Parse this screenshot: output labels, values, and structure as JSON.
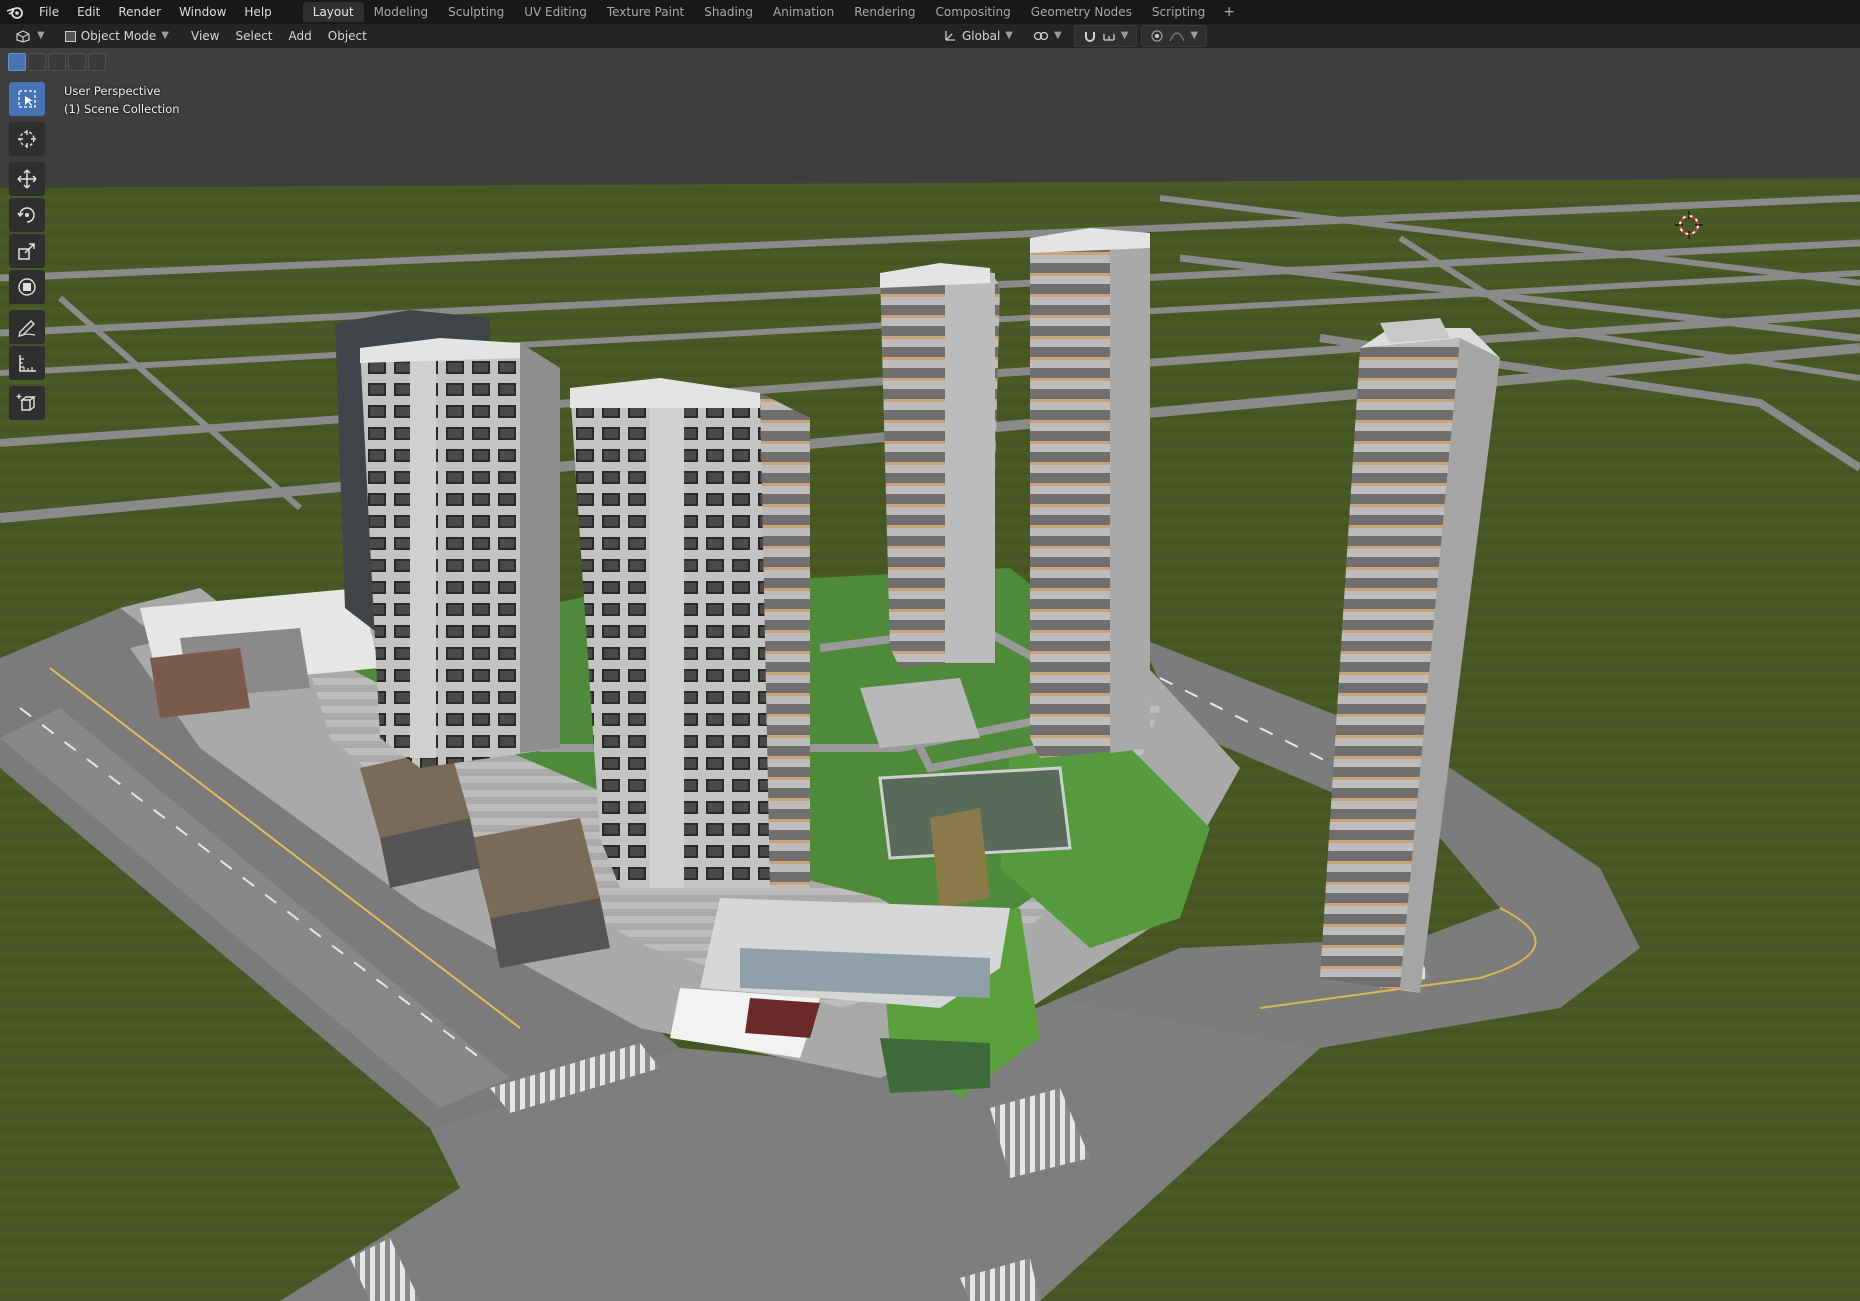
{
  "menu": {
    "items": [
      "File",
      "Edit",
      "Render",
      "Window",
      "Help"
    ]
  },
  "workspaces": {
    "tabs": [
      "Layout",
      "Modeling",
      "Sculpting",
      "UV Editing",
      "Texture Paint",
      "Shading",
      "Animation",
      "Rendering",
      "Compositing",
      "Geometry Nodes",
      "Scripting"
    ],
    "active": "Layout",
    "add_label": "+"
  },
  "viewport_header": {
    "mode": "Object Mode",
    "menus": [
      "View",
      "Select",
      "Add",
      "Object"
    ],
    "transform_orientation": "Global"
  },
  "viewport": {
    "perspective_label": "User Perspective",
    "collection_label": "(1) Scene Collection"
  },
  "toolbar": {
    "tools": [
      "select-box",
      "cursor",
      "move",
      "rotate",
      "scale",
      "transform",
      "annotate",
      "measure",
      "add-cube"
    ],
    "active_tool": "select-box"
  },
  "colors": {
    "topbar_bg": "#181818",
    "header_bg": "#242424",
    "accent_blue": "#4772b3",
    "sky": "#3d3d3d",
    "grass": "#4a5a24",
    "road": "#7f7f7f",
    "building": "#bdbdbd",
    "roof_garden": "#4f8a3a"
  }
}
